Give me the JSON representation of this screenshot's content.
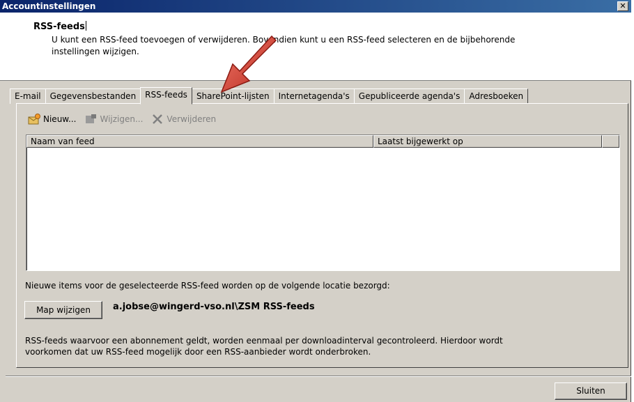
{
  "window": {
    "title": "Accountinstellingen",
    "close_glyph": "✕"
  },
  "header": {
    "title": "RSS-feeds",
    "desc_line1": "U kunt een RSS-feed toevoegen of verwijderen. Bovendien kunt u een RSS-feed selecteren en de bijbehorende",
    "desc_line2": "instellingen wijzigen."
  },
  "tabs": [
    {
      "label": "E-mail"
    },
    {
      "label": "Gegevensbestanden"
    },
    {
      "label": "RSS-feeds",
      "active": true
    },
    {
      "label": "SharePoint-lijsten"
    },
    {
      "label": "Internetagenda's"
    },
    {
      "label": "Gepubliceerde agenda's"
    },
    {
      "label": "Adresboeken"
    }
  ],
  "toolbar": {
    "new_label": "Nieuw...",
    "edit_label": "Wijzigen...",
    "delete_label": "Verwijderen"
  },
  "list": {
    "col_name": "Naam van feed",
    "col_updated": "Laatst bijgewerkt op"
  },
  "info": {
    "text": "Nieuwe items voor de geselecteerde RSS-feed worden op de volgende locatie bezorgd:"
  },
  "map": {
    "button_label": "Map wijzigen",
    "path": "a.jobse@wingerd-vso.nl\\ZSM RSS-feeds"
  },
  "footer": {
    "line1": "RSS-feeds waarvoor een abonnement geldt, worden eenmaal per downloadinterval gecontroleerd. Hierdoor wordt",
    "line2": "voorkomen dat uw RSS-feed mogelijk door een RSS-aanbieder wordt onderbroken."
  },
  "close_button": {
    "label": "Sluiten"
  },
  "colors": {
    "titlebar_start": "#0a246a",
    "titlebar_end": "#3a6ea5",
    "dialog_bg": "#d4d0c8",
    "arrow": "#d9463a"
  },
  "icons": {
    "new": "rss-new-icon",
    "edit": "edit-icon",
    "delete": "delete-x-icon",
    "annotation": "red-arrow-icon"
  }
}
